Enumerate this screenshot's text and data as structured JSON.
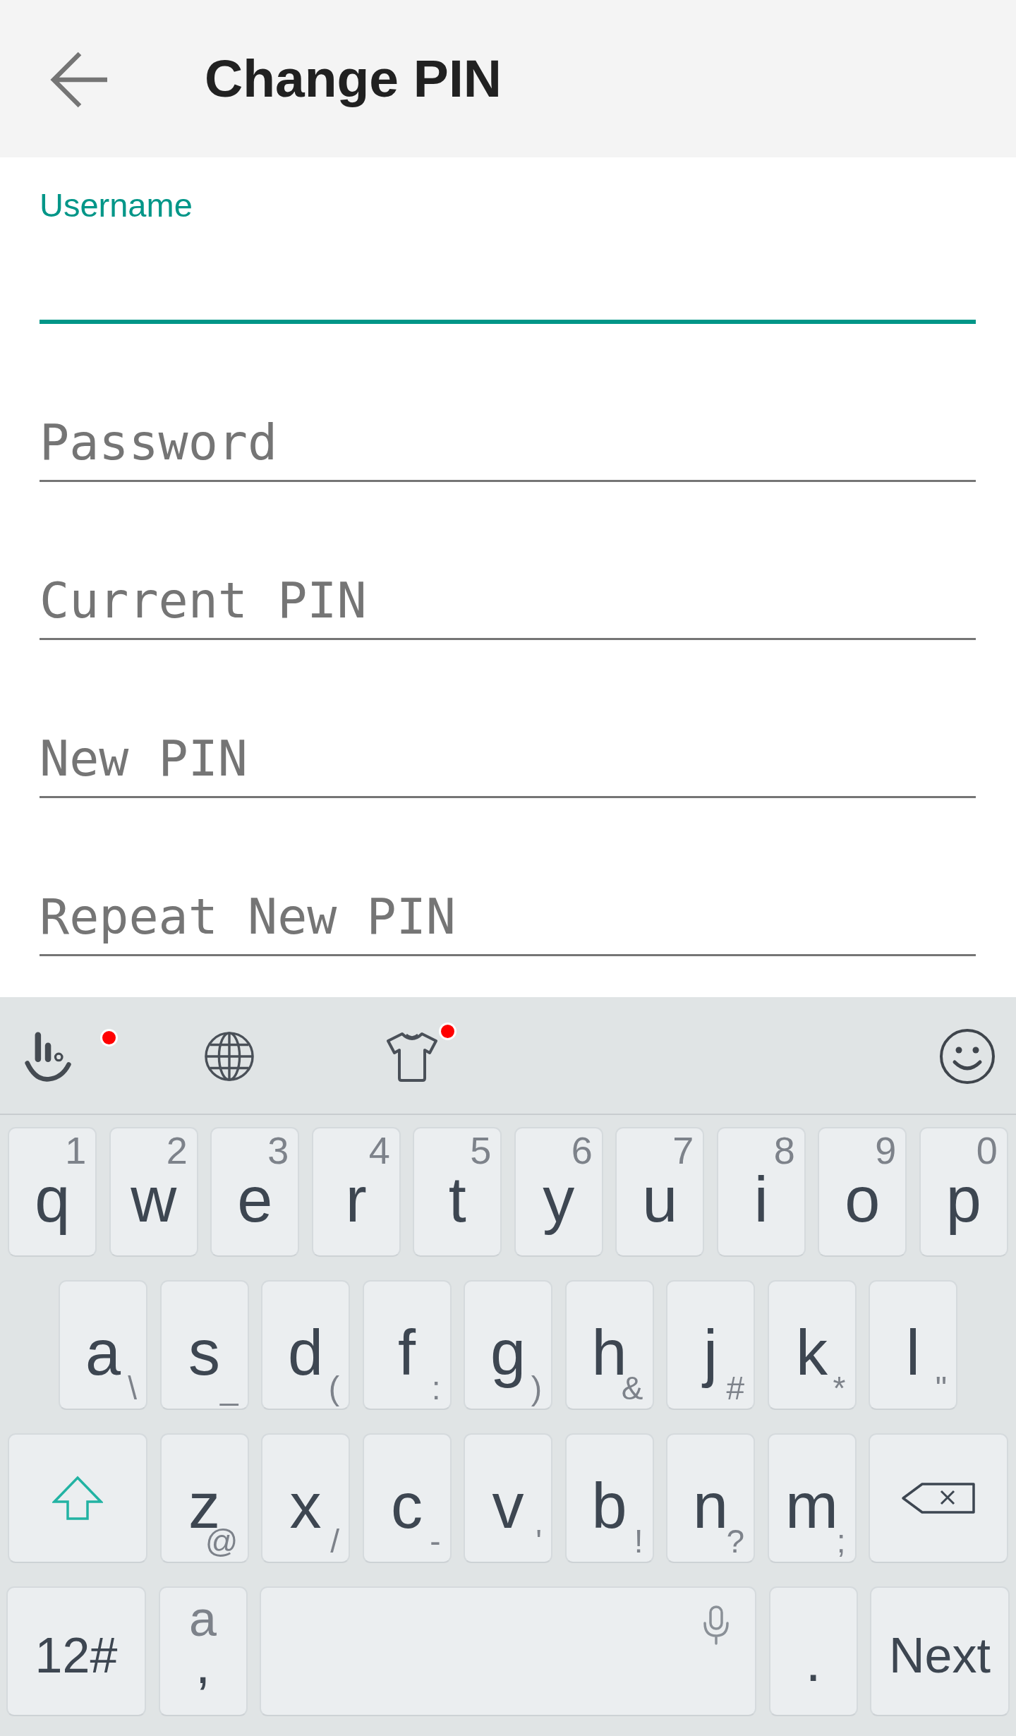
{
  "app_bar": {
    "title": "Change PIN"
  },
  "fields": [
    {
      "label": "Username",
      "focused": true
    },
    {
      "label": "Password",
      "focused": false
    },
    {
      "label": "Current PIN",
      "focused": false
    },
    {
      "label": "New PIN",
      "focused": false
    },
    {
      "label": "Repeat New PIN",
      "focused": false
    }
  ],
  "keyboard": {
    "toolbar": [
      {
        "kind": "brand",
        "dot": true
      },
      {
        "kind": "language",
        "dot": false
      },
      {
        "kind": "theme",
        "dot": true
      },
      {
        "kind": "emoji",
        "dot": false
      }
    ],
    "letter_rows": [
      [
        {
          "kind": "numbered",
          "label": "q",
          "hint": "1"
        },
        {
          "kind": "numbered",
          "label": "w",
          "hint": "2"
        },
        {
          "kind": "numbered",
          "label": "e",
          "hint": "3"
        },
        {
          "kind": "numbered",
          "label": "r",
          "hint": "4"
        },
        {
          "kind": "numbered",
          "label": "t",
          "hint": "5"
        },
        {
          "kind": "numbered",
          "label": "y",
          "hint": "6"
        },
        {
          "kind": "numbered",
          "label": "u",
          "hint": "7"
        },
        {
          "kind": "numbered",
          "label": "i",
          "hint": "8"
        },
        {
          "kind": "numbered",
          "label": "o",
          "hint": "9"
        },
        {
          "kind": "numbered",
          "label": "p",
          "hint": "0"
        }
      ],
      [
        {
          "kind": "letter",
          "label": "a",
          "hint": "\\"
        },
        {
          "kind": "letter",
          "label": "s",
          "hint": "_"
        },
        {
          "kind": "letter",
          "label": "d",
          "hint": "("
        },
        {
          "kind": "letter",
          "label": "f",
          "hint": ":"
        },
        {
          "kind": "letter",
          "label": "g",
          "hint": ")"
        },
        {
          "kind": "letter",
          "label": "h",
          "hint": "&"
        },
        {
          "kind": "letter",
          "label": "j",
          "hint": "#"
        },
        {
          "kind": "letter",
          "label": "k",
          "hint": "*"
        },
        {
          "kind": "letter",
          "label": "l",
          "hint": "\""
        }
      ],
      [
        {
          "kind": "shift"
        },
        {
          "kind": "letter",
          "label": "z",
          "hint": "@"
        },
        {
          "kind": "letter",
          "label": "x",
          "hint": "/"
        },
        {
          "kind": "letter",
          "label": "c",
          "hint": "-"
        },
        {
          "kind": "letter",
          "label": "v",
          "hint": "'"
        },
        {
          "kind": "letter",
          "label": "b",
          "hint": "!"
        },
        {
          "kind": "letter",
          "label": "n",
          "hint": "?"
        },
        {
          "kind": "letter",
          "label": "m",
          "hint": ";"
        },
        {
          "kind": "backspace"
        }
      ]
    ],
    "bottom_row": [
      {
        "kind": "symbols",
        "label": "12#"
      },
      {
        "kind": "comma",
        "label": ",",
        "hint": "a"
      },
      {
        "kind": "space"
      },
      {
        "kind": "period",
        "label": "."
      },
      {
        "kind": "action",
        "label": "Next"
      }
    ]
  }
}
